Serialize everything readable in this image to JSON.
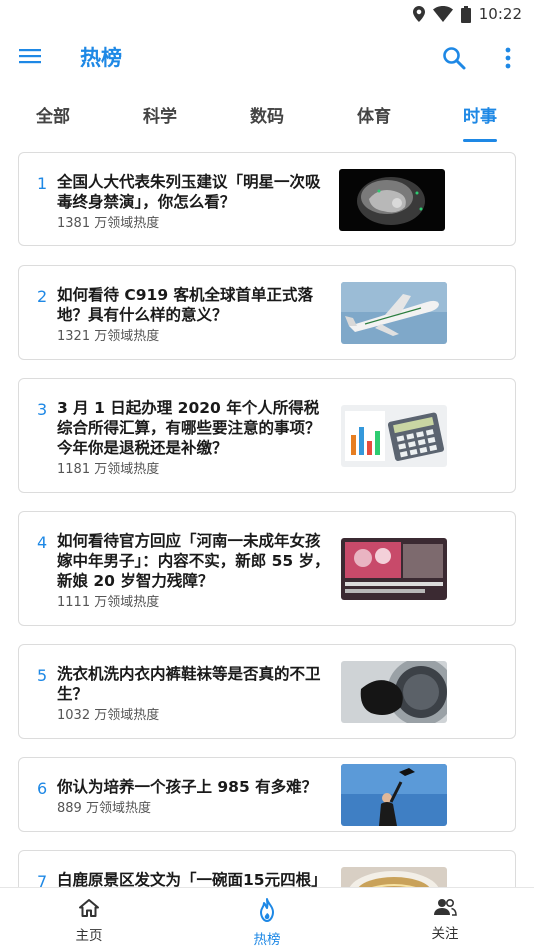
{
  "status_bar": {
    "time": "10:22",
    "icons": [
      "location-icon",
      "wifi-icon",
      "battery-icon"
    ]
  },
  "app_bar": {
    "title": "热榜",
    "icons": [
      "menu-icon",
      "search-icon",
      "more-vert-icon"
    ]
  },
  "tabs": [
    {
      "label": "全部",
      "active": false
    },
    {
      "label": "科学",
      "active": false
    },
    {
      "label": "数码",
      "active": false
    },
    {
      "label": "体育",
      "active": false
    },
    {
      "label": "时事",
      "active": true
    }
  ],
  "items": [
    {
      "rank": "1",
      "title": "全国人大代表朱列玉建议「明星一次吸毒终身禁演」，你怎么看？",
      "heat": "1381 万领域热度",
      "thumb": "brain-scan-image"
    },
    {
      "rank": "2",
      "title": "如何看待 C919 客机全球首单正式落地？具有什么样的意义？",
      "heat": "1321 万领域热度",
      "thumb": "airplane-image"
    },
    {
      "rank": "3",
      "title": "3 月 1 日起办理 2020 年个人所得税综合所得汇算，有哪些要注意的事项？今年你是退税还是补缴？",
      "heat": "1181 万领域热度",
      "thumb": "calculator-image"
    },
    {
      "rank": "4",
      "title": "如何看待官方回应「河南一未成年女孩嫁中年男子」：内容不实，新郎 55 岁，新娘 20 岁智力残障？",
      "heat": "1111 万领域热度",
      "thumb": "news-video-image"
    },
    {
      "rank": "5",
      "title": "洗衣机洗内衣内裤鞋袜等是否真的不卫生？",
      "heat": "1032 万领域热度",
      "thumb": "washing-machine-image"
    },
    {
      "rank": "6",
      "title": "你认为培养一个孩子上 985 有多难？",
      "heat": "889 万领域热度",
      "thumb": "graduation-image"
    },
    {
      "rank": "7",
      "title": "白鹿原景区发文为「一碗面15元四根」",
      "heat": "",
      "thumb": "noodle-bowl-image"
    }
  ],
  "bottom_nav": [
    {
      "label": "主页",
      "icon": "home-icon",
      "active": false
    },
    {
      "label": "热榜",
      "icon": "flame-icon",
      "active": true
    },
    {
      "label": "关注",
      "icon": "people-icon",
      "active": false
    }
  ],
  "colors": {
    "accent": "#1e88e5",
    "text": "#1a1a1a",
    "secondary_text": "#555555",
    "card_border": "#dcdcdc"
  }
}
